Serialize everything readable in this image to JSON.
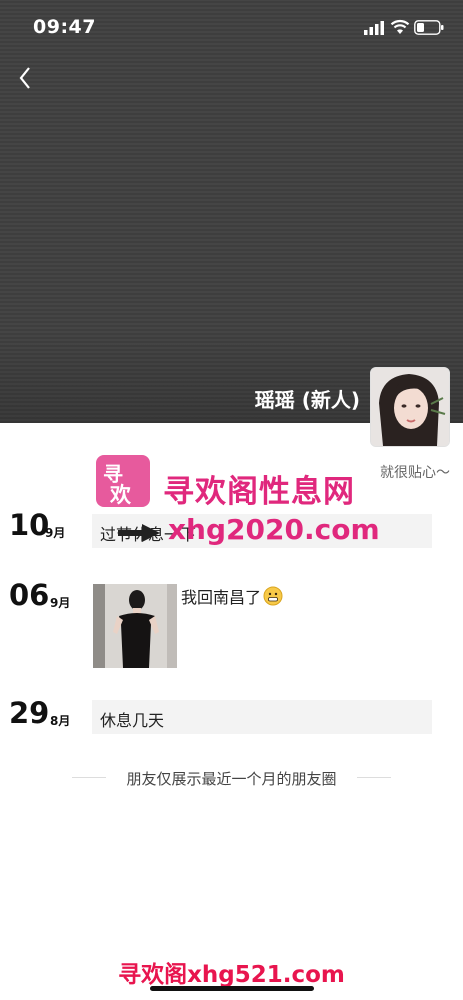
{
  "status_bar": {
    "time": "09:47"
  },
  "profile": {
    "name": "瑶瑶 (新人)",
    "signature": "就很贴心～"
  },
  "moments": [
    {
      "day": "10",
      "month": "9月",
      "text": "过节休息一下"
    },
    {
      "day": "06",
      "month": "9月",
      "caption": "我回南昌了"
    },
    {
      "day": "29",
      "month": "8月",
      "text": "休息几天"
    }
  ],
  "footer": {
    "notice": "朋友仅展示最近一个月的朋友圈"
  },
  "watermark": {
    "title": "寻欢阁性息网",
    "url": "xhg2020.com",
    "bottom": "寻欢阁xhg521.com",
    "logo_char_top": "寻",
    "logo_char_bottom": "欢"
  },
  "colors": {
    "cover": "#414141",
    "watermark": "#e0287d",
    "watermark_bottom": "#e8154e"
  }
}
